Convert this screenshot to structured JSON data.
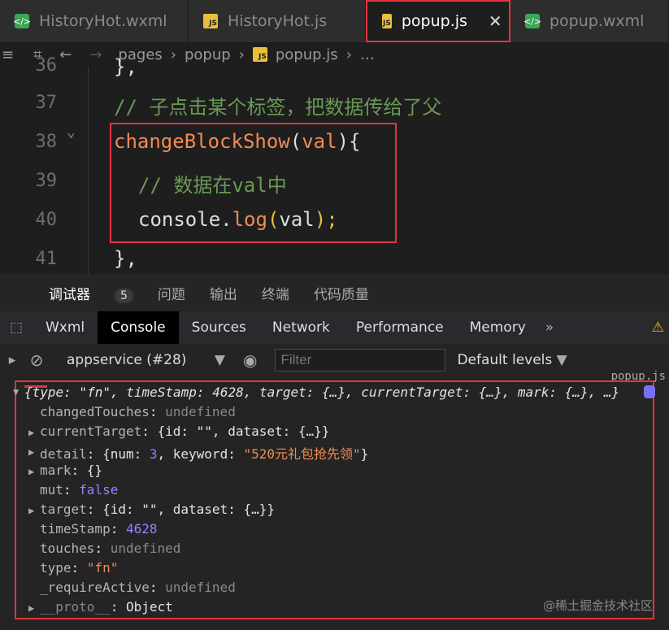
{
  "tabs": [
    {
      "label": "HistoryHot.wxml",
      "icon": "wxml-file-icon"
    },
    {
      "label": "HistoryHot.js",
      "icon": "js-file-icon"
    },
    {
      "label": "popup.js",
      "icon": "js-file-icon",
      "active": true
    },
    {
      "label": "popup.wxml",
      "icon": "wxml-file-icon"
    }
  ],
  "breadcrumb": {
    "p1": "pages",
    "p2": "popup",
    "p3": "popup.js",
    "p4": "…"
  },
  "code": {
    "lines": [
      "36",
      "37",
      "38",
      "39",
      "40",
      "41"
    ],
    "l36": "},",
    "l37": "// 子点击某个标签，把数据传给了父",
    "l38_fn": "changeBlockShow",
    "l38_p": "(",
    "l38_arg": "val",
    "l38_e": "){",
    "l39": "// 数据在val中",
    "l40_a": "console.",
    "l40_b": "log",
    "l40_c": "(",
    "l40_d": "val",
    "l40_e": ");",
    "l41": "},"
  },
  "panel": {
    "t1": "调试器",
    "badge": "5",
    "t2": "问题",
    "t3": "输出",
    "t4": "终端",
    "t5": "代码质量"
  },
  "devtools": {
    "tabs": [
      "Wxml",
      "Console",
      "Sources",
      "Network",
      "Performance",
      "Memory"
    ],
    "more": "»"
  },
  "filterbar": {
    "context": "appservice (#28)",
    "filter_placeholder": "Filter",
    "levels": "Default levels"
  },
  "console": {
    "source": "popup.js",
    "summary": "{type: \"fn\", timeStamp: 4628, target: {…}, currentTarget: {…}, mark: {…}, …}",
    "rows": [
      {
        "key": "changedTouches",
        "val": "undefined"
      },
      {
        "key": "currentTarget",
        "val": "{id: \"\", dataset: {…}}"
      },
      {
        "key": "detail",
        "val_a": "{num: ",
        "num": "3",
        "val_b": ", keyword: ",
        "str": "\"520元礼包抢先领\"",
        "val_c": "}"
      },
      {
        "key": "mark",
        "val": "{}"
      },
      {
        "key": "mut",
        "val": "false"
      },
      {
        "key": "target",
        "val": "{id: \"\", dataset: {…}}"
      },
      {
        "key": "timeStamp",
        "val": "4628"
      },
      {
        "key": "touches",
        "val": "undefined"
      },
      {
        "key": "type",
        "val": "\"fn\""
      },
      {
        "key": "_requireActive",
        "val": "undefined"
      },
      {
        "key": "__proto__",
        "val": "Object"
      }
    ]
  },
  "watermark": "@稀土掘金技术社区",
  "colors": {
    "highlight": "#e0363f",
    "keyword": "#f28b54",
    "comment": "#6a9955",
    "fn": "#dcdcaa"
  }
}
